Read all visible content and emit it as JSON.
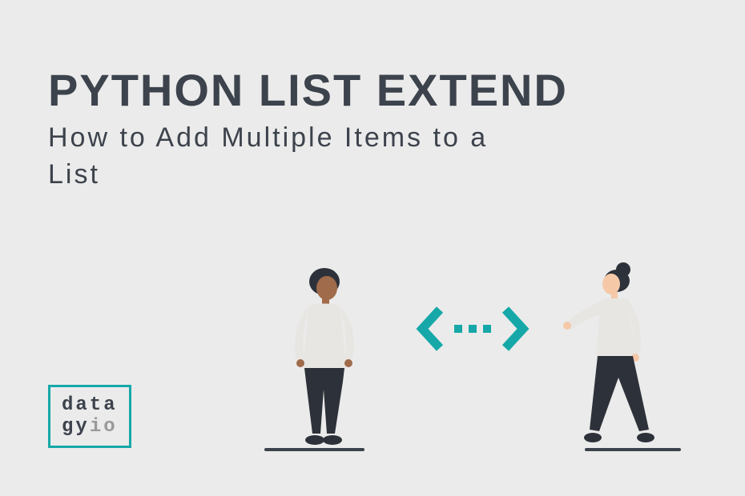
{
  "title": "PYTHON LIST EXTEND",
  "subtitle": "How to Add Multiple Items to a List",
  "logo": {
    "line1": "data",
    "line2_gy": "gy",
    "line2_io": "io"
  },
  "colors": {
    "background": "#ebebeb",
    "text_dark": "#3d434c",
    "accent": "#16a8a8",
    "muted": "#999999",
    "skin1": "#a06b4a",
    "skin2": "#f5c9a8",
    "clothing_light": "#e8e6e3",
    "pants_dark": "#2d3139"
  }
}
